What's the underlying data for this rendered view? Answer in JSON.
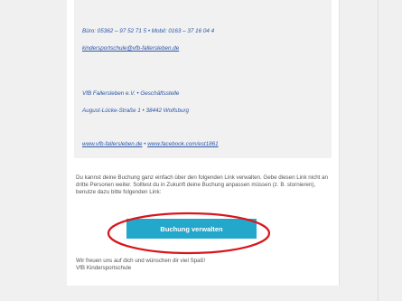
{
  "signature": {
    "phone_line": "Büro: 05362 – 97 52 71 5 • Mobil: 0163 – 37 16 04 4",
    "email": "kindersportschule@vfb-fallersleben.de",
    "org_line": "VfB Fallersleben e.V. • Geschäftsstelle",
    "address_line": "August-Lücke-Straße 1 • 38442 Wolfsburg",
    "website": "www.vfb-fallersleben.de",
    "link_separator": " • ",
    "facebook": "www.facebook.com/est1861"
  },
  "body": {
    "paragraph": "Du kannst deine Buchung ganz einfach über den folgenden Link verwalten. Gebe diesen Link nicht an dritte Personen weiter. Solltest du in Zukunft deine Buchung anpassen müssen (z. B. stornieren), benutze dazu bitte folgenden Link:"
  },
  "cta": {
    "label": "Buchung verwalten"
  },
  "closing": {
    "line1": "Wir freuen uns auf dich und wünschen dir viel Spaß!",
    "line2": "VfB Kindersportschule"
  },
  "colors": {
    "link": "#2b56a8",
    "button": "#23a8cc",
    "annotation": "#d9151b",
    "background": "#f0f0f0"
  }
}
